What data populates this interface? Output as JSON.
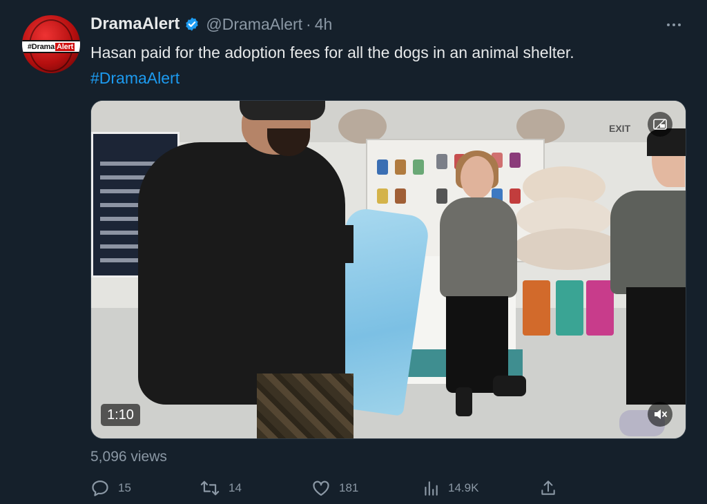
{
  "author": {
    "display_name": "DramaAlert",
    "handle": "@DramaAlert",
    "separator": "·",
    "time": "4h",
    "avatar_text_left": "#Drama",
    "avatar_text_right": "Alert",
    "verified": true
  },
  "tweet": {
    "text": "Hasan paid for the adoption fees for all the dogs in an animal shelter.",
    "hashtag": "#DramaAlert"
  },
  "media": {
    "type": "video",
    "duration": "1:10",
    "pip_icon": "picture-in-picture-icon",
    "mute_icon": "speaker-muted-icon",
    "sign_text": "EXIT"
  },
  "stats": {
    "views_label": "5,096 views"
  },
  "actions": {
    "reply_count": "15",
    "retweet_count": "14",
    "like_count": "181",
    "view_count": "14.9K"
  },
  "colors": {
    "background": "#15202b",
    "accent": "#1d9bf0",
    "secondary_text": "#8b98a5"
  }
}
